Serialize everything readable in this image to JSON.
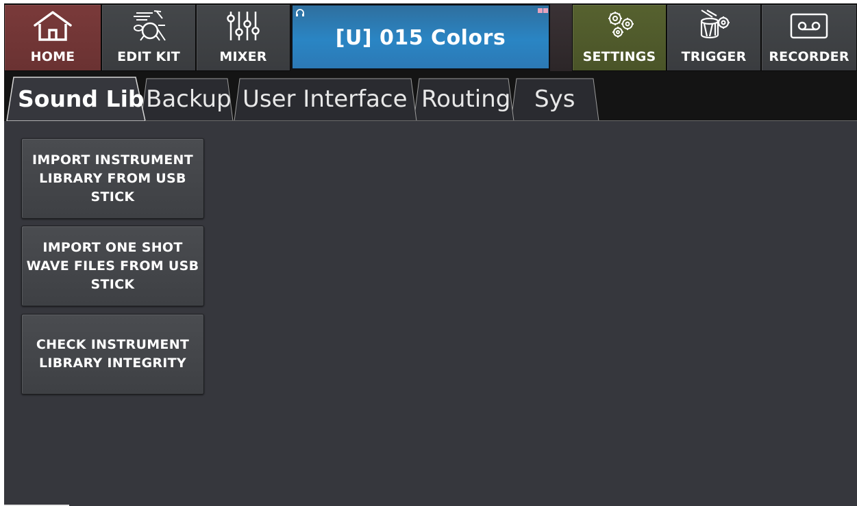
{
  "nav": {
    "home": "HOME",
    "edit_kit": "EDIT KIT",
    "mixer": "MIXER",
    "settings": "SETTINGS",
    "trigger": "TRIGGER",
    "recorder": "RECORDER"
  },
  "display": {
    "kit_name": "[U] 015 Colors"
  },
  "tabs": [
    {
      "label": "Sound Lib",
      "active": true
    },
    {
      "label": "Backup",
      "active": false
    },
    {
      "label": "User Interface",
      "active": false
    },
    {
      "label": "Routing",
      "active": false
    },
    {
      "label": "Sys",
      "active": false
    }
  ],
  "actions": [
    {
      "label": "IMPORT INSTRUMENT LIBRARY FROM USB STICK"
    },
    {
      "label": "IMPORT ONE SHOT WAVE FILES FROM USB STICK"
    },
    {
      "label": "CHECK INSTRUMENT LIBRARY INTEGRITY"
    }
  ],
  "colors": {
    "home": "#6e3535",
    "settings": "#505a2b",
    "display": "#2a85c4",
    "background": "#36373d"
  },
  "icons": [
    "home-icon",
    "drum-kit-icon",
    "mixer-faders-icon",
    "headphones-icon",
    "gears-icon",
    "trigger-drum-icon",
    "cassette-icon"
  ]
}
